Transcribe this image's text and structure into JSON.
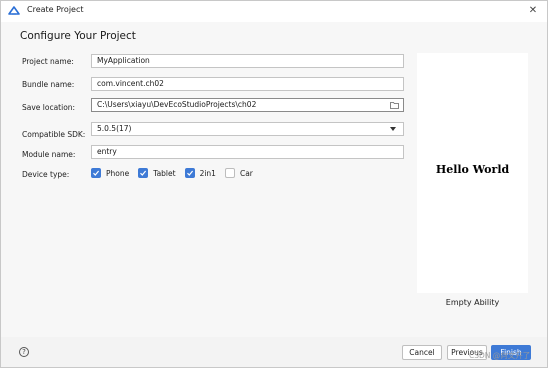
{
  "window": {
    "title": "Create Project",
    "close_glyph": "✕"
  },
  "page": {
    "heading": "Configure Your Project"
  },
  "form": {
    "project_name": {
      "label": "Project name:",
      "value": "MyApplication"
    },
    "bundle_name": {
      "label": "Bundle name:",
      "value": "com.vincent.ch02"
    },
    "save_location": {
      "label": "Save location:",
      "value": "C:\\Users\\xiayu\\DevEcoStudioProjects\\ch02"
    },
    "compatible_sdk": {
      "label": "Compatible SDK:",
      "value": "5.0.5(17)"
    },
    "module_name": {
      "label": "Module name:",
      "value": "entry"
    },
    "device_type": {
      "label": "Device type:",
      "options": [
        {
          "label": "Phone",
          "checked": true
        },
        {
          "label": "Tablet",
          "checked": true
        },
        {
          "label": "2in1",
          "checked": true
        },
        {
          "label": "Car",
          "checked": false
        }
      ]
    }
  },
  "preview": {
    "text": "Hello World",
    "template_name": "Empty Ability"
  },
  "footer": {
    "help_glyph": "?",
    "cancel_label": "Cancel",
    "previous_label": "Previous",
    "finish_label": "Finish"
  },
  "watermark": "CSDN @向文开了",
  "colors": {
    "accent": "#3e7ad6",
    "background": "#f7f7f7"
  },
  "icons": {
    "logo": "harmony-logo-icon",
    "folder": "folder-icon",
    "dropdown": "chevron-down-icon",
    "help": "help-icon",
    "close": "close-icon"
  }
}
